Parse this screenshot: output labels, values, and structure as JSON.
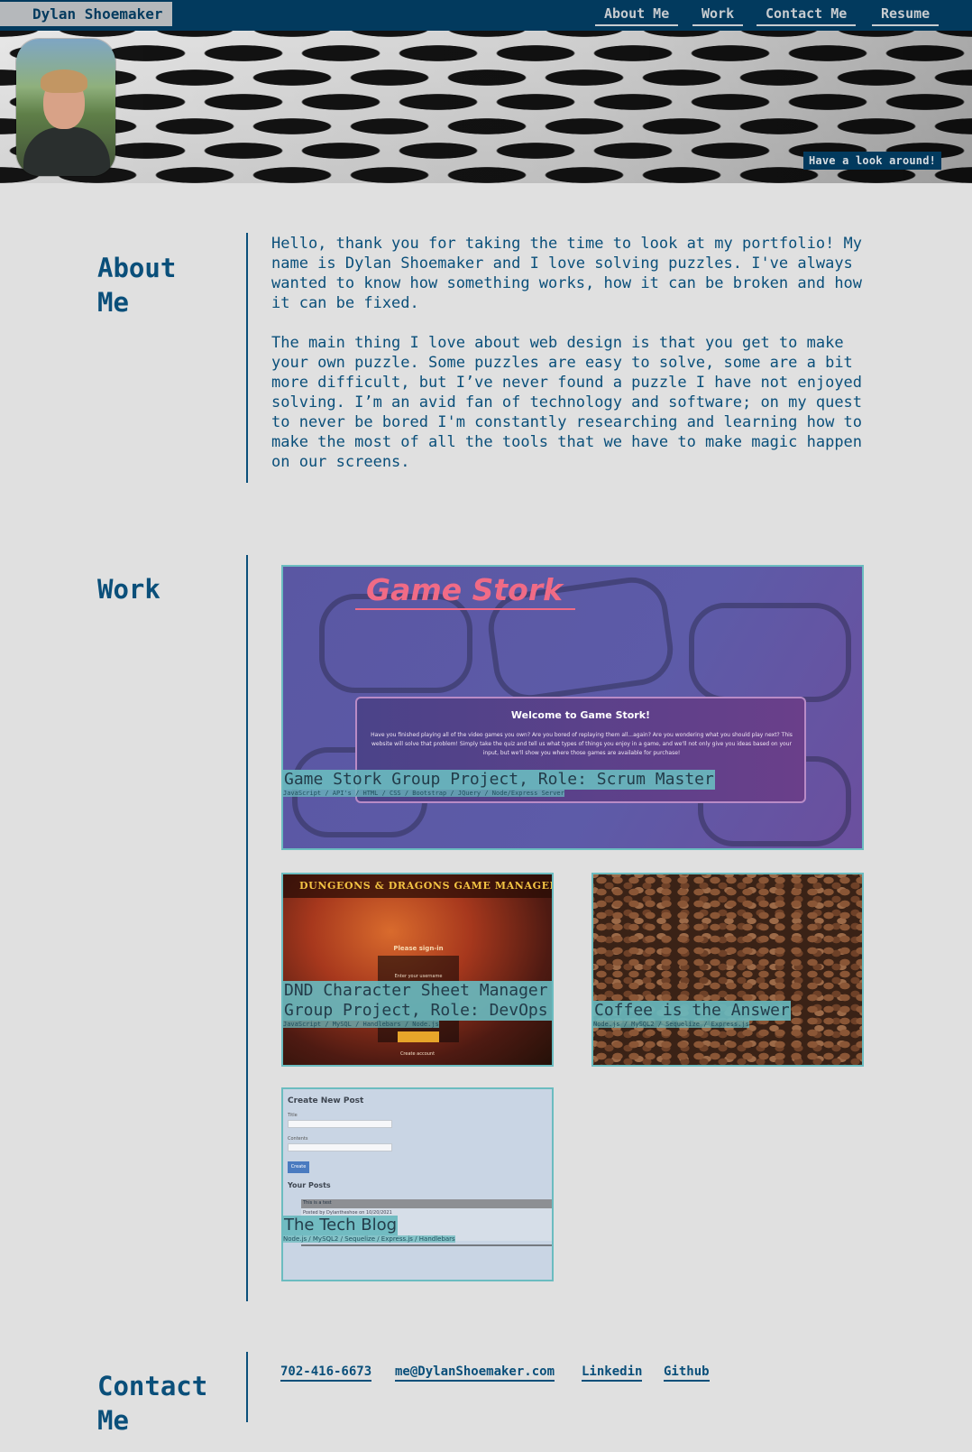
{
  "nav": {
    "brand": "Dylan Shoemaker",
    "links": [
      "About Me",
      "Work",
      "Contact Me",
      "Resume"
    ]
  },
  "hero": {
    "tag": "Have a look around!"
  },
  "about": {
    "title_line1": "About",
    "title_line2": "Me",
    "paragraphs": [
      "Hello, thank you for taking the time to look at my portfolio! My name is Dylan Shoemaker and I love solving puzzles. I've always wanted to know how something works, how it can be broken and how it can be fixed.",
      "The main thing I love about web design is that you get to make your own puzzle. Some puzzles are easy to solve, some are a bit more difficult, but I’ve never found a puzzle I have not enjoyed solving. I’m an avid fan of technology and software; on my quest to never be bored I'm constantly researching and learning how to make the most of all the tools that we have to make magic happen on our screens."
    ]
  },
  "work": {
    "title": "Work",
    "projects": [
      {
        "label": "Game Stork Group Project, Role: Scrum Master",
        "tech": "JavaScript / API's / HTML / CSS / Bootstrap / JQuery / Node/Express Server",
        "preview_title": "Game Stork",
        "preview_box_title": "Welcome to Game Stork!",
        "preview_box_text": "Have you finished playing all of the video games you own? Are you bored of replaying them all...again? Are you wondering what you should play next? This website will solve that problem! Simply take the quiz and tell us what types of things you enjoy in a game, and we'll not only give you ideas based on your input, but we'll show you where those games are available for purchase!"
      },
      {
        "label": "DND Character Sheet Manager Group Project, Role: DevOps",
        "tech": "JavaScript / MySQL / Handlebars / Node.js",
        "preview_header": "DUNGEONS & DRAGONS GAME MANAGER",
        "preview_signin": "Please sign-in",
        "preview_username": "Enter your username",
        "preview_create": "Create account"
      },
      {
        "label": "Coffee is the Answer",
        "tech": "Node.js / MySQL2 / Sequelize / Express.js"
      },
      {
        "label": "The Tech Blog",
        "tech": "Node.js / MySQL2 / Sequelize / Express.js / Handlebars",
        "preview_heading": "Create New Post",
        "preview_title_label": "Title",
        "preview_contents_label": "Contents",
        "preview_create_btn": "Create",
        "preview_your_posts": "Your Posts",
        "preview_post_title": "This is a test",
        "preview_post_meta": "Posted by Dylantheshoe on 10/20/2021"
      }
    ]
  },
  "contact": {
    "title_line1": "Contact",
    "title_line2": "Me",
    "links": [
      "702-416-6673",
      "me@DylanShoemaker.com",
      "Linkedin",
      "Github"
    ]
  }
}
